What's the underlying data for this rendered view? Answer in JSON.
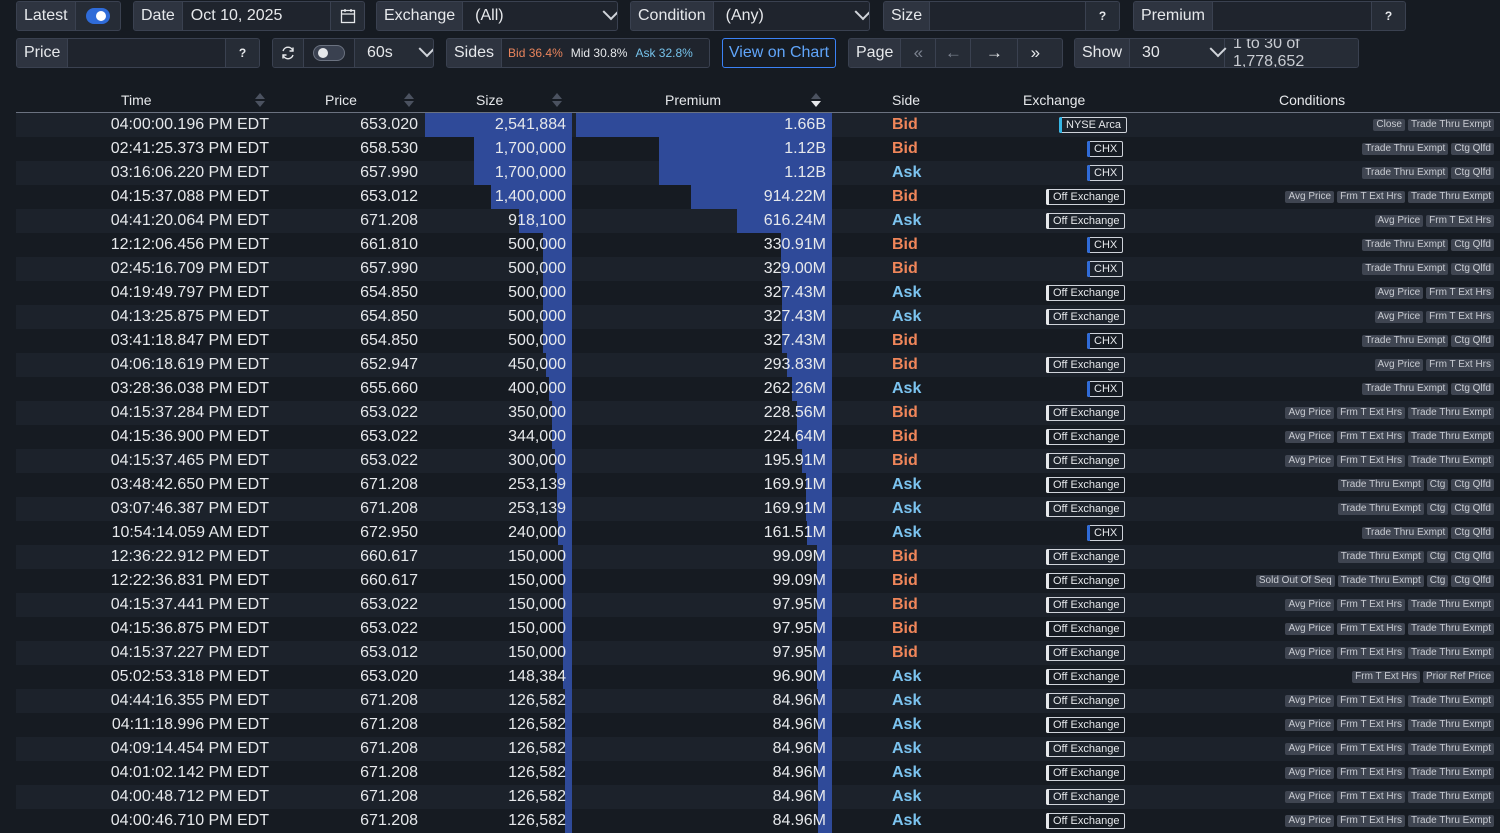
{
  "controls": {
    "latest_label": "Latest",
    "date_label": "Date",
    "date_value": "Oct 10, 2025",
    "exchange_label": "Exchange",
    "exchange_value": "(All)",
    "condition_label": "Condition",
    "condition_value": "(Any)",
    "size_label": "Size",
    "premium_label": "Premium",
    "help": "?",
    "price_label": "Price",
    "interval_value": "60s",
    "sides_label": "Sides",
    "sides_bid": "Bid 36.4%",
    "sides_mid": "Mid 30.8%",
    "sides_ask": "Ask 32.8%",
    "view_chart": "View on Chart",
    "page_label": "Page",
    "show_label": "Show",
    "show_value": "30",
    "range_text": "1 to 30 of 1,778,652"
  },
  "columns": {
    "time": "Time",
    "price": "Price",
    "size": "Size",
    "premium": "Premium",
    "side": "Side",
    "exchange": "Exchange",
    "conditions": "Conditions"
  },
  "max_size": 2541884,
  "max_premium": 1660000000,
  "rows": [
    {
      "time": "04:00:00.196 PM EDT",
      "price": "653.020",
      "size": "2,541,884",
      "size_n": 2541884,
      "premium": "1.66B",
      "premium_n": 1660000000,
      "side": "Bid",
      "exchange": "NYSE Arca",
      "ex": "nyse",
      "conditions": [
        "Close",
        "Trade Thru Exmpt"
      ]
    },
    {
      "time": "02:41:25.373 PM EDT",
      "price": "658.530",
      "size": "1,700,000",
      "size_n": 1700000,
      "premium": "1.12B",
      "premium_n": 1120000000,
      "side": "Bid",
      "exchange": "CHX",
      "ex": "chx",
      "conditions": [
        "Trade Thru Exmpt",
        "Ctg Qlfd"
      ]
    },
    {
      "time": "03:16:06.220 PM EDT",
      "price": "657.990",
      "size": "1,700,000",
      "size_n": 1700000,
      "premium": "1.12B",
      "premium_n": 1120000000,
      "side": "Ask",
      "exchange": "CHX",
      "ex": "chx",
      "conditions": [
        "Trade Thru Exmpt",
        "Ctg Qlfd"
      ]
    },
    {
      "time": "04:15:37.088 PM EDT",
      "price": "653.012",
      "size": "1,400,000",
      "size_n": 1400000,
      "premium": "914.22M",
      "premium_n": 914220000,
      "side": "Bid",
      "exchange": "Off Exchange",
      "ex": "off",
      "conditions": [
        "Avg Price",
        "Frm T Ext Hrs",
        "Trade Thru Exmpt"
      ]
    },
    {
      "time": "04:41:20.064 PM EDT",
      "price": "671.208",
      "size": "918,100",
      "size_n": 918100,
      "premium": "616.24M",
      "premium_n": 616240000,
      "side": "Ask",
      "exchange": "Off Exchange",
      "ex": "off",
      "conditions": [
        "Avg Price",
        "Frm T Ext Hrs"
      ]
    },
    {
      "time": "12:12:06.456 PM EDT",
      "price": "661.810",
      "size": "500,000",
      "size_n": 500000,
      "premium": "330.91M",
      "premium_n": 330910000,
      "side": "Bid",
      "exchange": "CHX",
      "ex": "chx",
      "conditions": [
        "Trade Thru Exmpt",
        "Ctg Qlfd"
      ]
    },
    {
      "time": "02:45:16.709 PM EDT",
      "price": "657.990",
      "size": "500,000",
      "size_n": 500000,
      "premium": "329.00M",
      "premium_n": 329000000,
      "side": "Bid",
      "exchange": "CHX",
      "ex": "chx",
      "conditions": [
        "Trade Thru Exmpt",
        "Ctg Qlfd"
      ]
    },
    {
      "time": "04:19:49.797 PM EDT",
      "price": "654.850",
      "size": "500,000",
      "size_n": 500000,
      "premium": "327.43M",
      "premium_n": 327430000,
      "side": "Ask",
      "exchange": "Off Exchange",
      "ex": "off",
      "conditions": [
        "Avg Price",
        "Frm T Ext Hrs"
      ]
    },
    {
      "time": "04:13:25.875 PM EDT",
      "price": "654.850",
      "size": "500,000",
      "size_n": 500000,
      "premium": "327.43M",
      "premium_n": 327430000,
      "side": "Ask",
      "exchange": "Off Exchange",
      "ex": "off",
      "conditions": [
        "Avg Price",
        "Frm T Ext Hrs"
      ]
    },
    {
      "time": "03:41:18.847 PM EDT",
      "price": "654.850",
      "size": "500,000",
      "size_n": 500000,
      "premium": "327.43M",
      "premium_n": 327430000,
      "side": "Bid",
      "exchange": "CHX",
      "ex": "chx",
      "conditions": [
        "Trade Thru Exmpt",
        "Ctg Qlfd"
      ]
    },
    {
      "time": "04:06:18.619 PM EDT",
      "price": "652.947",
      "size": "450,000",
      "size_n": 450000,
      "premium": "293.83M",
      "premium_n": 293830000,
      "side": "Bid",
      "exchange": "Off Exchange",
      "ex": "off",
      "conditions": [
        "Avg Price",
        "Frm T Ext Hrs"
      ]
    },
    {
      "time": "03:28:36.038 PM EDT",
      "price": "655.660",
      "size": "400,000",
      "size_n": 400000,
      "premium": "262.26M",
      "premium_n": 262260000,
      "side": "Ask",
      "exchange": "CHX",
      "ex": "chx",
      "conditions": [
        "Trade Thru Exmpt",
        "Ctg Qlfd"
      ]
    },
    {
      "time": "04:15:37.284 PM EDT",
      "price": "653.022",
      "size": "350,000",
      "size_n": 350000,
      "premium": "228.56M",
      "premium_n": 228560000,
      "side": "Bid",
      "exchange": "Off Exchange",
      "ex": "off",
      "conditions": [
        "Avg Price",
        "Frm T Ext Hrs",
        "Trade Thru Exmpt"
      ]
    },
    {
      "time": "04:15:36.900 PM EDT",
      "price": "653.022",
      "size": "344,000",
      "size_n": 344000,
      "premium": "224.64M",
      "premium_n": 224640000,
      "side": "Bid",
      "exchange": "Off Exchange",
      "ex": "off",
      "conditions": [
        "Avg Price",
        "Frm T Ext Hrs",
        "Trade Thru Exmpt"
      ]
    },
    {
      "time": "04:15:37.465 PM EDT",
      "price": "653.022",
      "size": "300,000",
      "size_n": 300000,
      "premium": "195.91M",
      "premium_n": 195910000,
      "side": "Bid",
      "exchange": "Off Exchange",
      "ex": "off",
      "conditions": [
        "Avg Price",
        "Frm T Ext Hrs",
        "Trade Thru Exmpt"
      ]
    },
    {
      "time": "03:48:42.650 PM EDT",
      "price": "671.208",
      "size": "253,139",
      "size_n": 253139,
      "premium": "169.91M",
      "premium_n": 169910000,
      "side": "Ask",
      "exchange": "Off Exchange",
      "ex": "off",
      "conditions": [
        "Trade Thru Exmpt",
        "Ctg",
        "Ctg Qlfd"
      ]
    },
    {
      "time": "03:07:46.387 PM EDT",
      "price": "671.208",
      "size": "253,139",
      "size_n": 253139,
      "premium": "169.91M",
      "premium_n": 169910000,
      "side": "Ask",
      "exchange": "Off Exchange",
      "ex": "off",
      "conditions": [
        "Trade Thru Exmpt",
        "Ctg",
        "Ctg Qlfd"
      ]
    },
    {
      "time": "10:54:14.059 AM EDT",
      "price": "672.950",
      "size": "240,000",
      "size_n": 240000,
      "premium": "161.51M",
      "premium_n": 161510000,
      "side": "Ask",
      "exchange": "CHX",
      "ex": "chx",
      "conditions": [
        "Trade Thru Exmpt",
        "Ctg Qlfd"
      ]
    },
    {
      "time": "12:36:22.912 PM EDT",
      "price": "660.617",
      "size": "150,000",
      "size_n": 150000,
      "premium": "99.09M",
      "premium_n": 99090000,
      "side": "Bid",
      "exchange": "Off Exchange",
      "ex": "off",
      "conditions": [
        "Trade Thru Exmpt",
        "Ctg",
        "Ctg Qlfd"
      ]
    },
    {
      "time": "12:22:36.831 PM EDT",
      "price": "660.617",
      "size": "150,000",
      "size_n": 150000,
      "premium": "99.09M",
      "premium_n": 99090000,
      "side": "Bid",
      "exchange": "Off Exchange",
      "ex": "off",
      "conditions": [
        "Sold Out Of Seq",
        "Trade Thru Exmpt",
        "Ctg",
        "Ctg Qlfd"
      ]
    },
    {
      "time": "04:15:37.441 PM EDT",
      "price": "653.022",
      "size": "150,000",
      "size_n": 150000,
      "premium": "97.95M",
      "premium_n": 97950000,
      "side": "Bid",
      "exchange": "Off Exchange",
      "ex": "off",
      "conditions": [
        "Avg Price",
        "Frm T Ext Hrs",
        "Trade Thru Exmpt"
      ]
    },
    {
      "time": "04:15:36.875 PM EDT",
      "price": "653.022",
      "size": "150,000",
      "size_n": 150000,
      "premium": "97.95M",
      "premium_n": 97950000,
      "side": "Bid",
      "exchange": "Off Exchange",
      "ex": "off",
      "conditions": [
        "Avg Price",
        "Frm T Ext Hrs",
        "Trade Thru Exmpt"
      ]
    },
    {
      "time": "04:15:37.227 PM EDT",
      "price": "653.012",
      "size": "150,000",
      "size_n": 150000,
      "premium": "97.95M",
      "premium_n": 97950000,
      "side": "Bid",
      "exchange": "Off Exchange",
      "ex": "off",
      "conditions": [
        "Avg Price",
        "Frm T Ext Hrs",
        "Trade Thru Exmpt"
      ]
    },
    {
      "time": "05:02:53.318 PM EDT",
      "price": "653.020",
      "size": "148,384",
      "size_n": 148384,
      "premium": "96.90M",
      "premium_n": 96900000,
      "side": "Ask",
      "exchange": "Off Exchange",
      "ex": "off",
      "conditions": [
        "Frm T Ext Hrs",
        "Prior Ref Price"
      ]
    },
    {
      "time": "04:44:16.355 PM EDT",
      "price": "671.208",
      "size": "126,582",
      "size_n": 126582,
      "premium": "84.96M",
      "premium_n": 84960000,
      "side": "Ask",
      "exchange": "Off Exchange",
      "ex": "off",
      "conditions": [
        "Avg Price",
        "Frm T Ext Hrs",
        "Trade Thru Exmpt"
      ]
    },
    {
      "time": "04:11:18.996 PM EDT",
      "price": "671.208",
      "size": "126,582",
      "size_n": 126582,
      "premium": "84.96M",
      "premium_n": 84960000,
      "side": "Ask",
      "exchange": "Off Exchange",
      "ex": "off",
      "conditions": [
        "Avg Price",
        "Frm T Ext Hrs",
        "Trade Thru Exmpt"
      ]
    },
    {
      "time": "04:09:14.454 PM EDT",
      "price": "671.208",
      "size": "126,582",
      "size_n": 126582,
      "premium": "84.96M",
      "premium_n": 84960000,
      "side": "Ask",
      "exchange": "Off Exchange",
      "ex": "off",
      "conditions": [
        "Avg Price",
        "Frm T Ext Hrs",
        "Trade Thru Exmpt"
      ]
    },
    {
      "time": "04:01:02.142 PM EDT",
      "price": "671.208",
      "size": "126,582",
      "size_n": 126582,
      "premium": "84.96M",
      "premium_n": 84960000,
      "side": "Ask",
      "exchange": "Off Exchange",
      "ex": "off",
      "conditions": [
        "Avg Price",
        "Frm T Ext Hrs",
        "Trade Thru Exmpt"
      ]
    },
    {
      "time": "04:00:48.712 PM EDT",
      "price": "671.208",
      "size": "126,582",
      "size_n": 126582,
      "premium": "84.96M",
      "premium_n": 84960000,
      "side": "Ask",
      "exchange": "Off Exchange",
      "ex": "off",
      "conditions": [
        "Avg Price",
        "Frm T Ext Hrs",
        "Trade Thru Exmpt"
      ]
    },
    {
      "time": "04:00:46.710 PM EDT",
      "price": "671.208",
      "size": "126,582",
      "size_n": 126582,
      "premium": "84.96M",
      "premium_n": 84960000,
      "side": "Ask",
      "exchange": "Off Exchange",
      "ex": "off",
      "conditions": [
        "Avg Price",
        "Frm T Ext Hrs",
        "Trade Thru Exmpt"
      ]
    }
  ]
}
